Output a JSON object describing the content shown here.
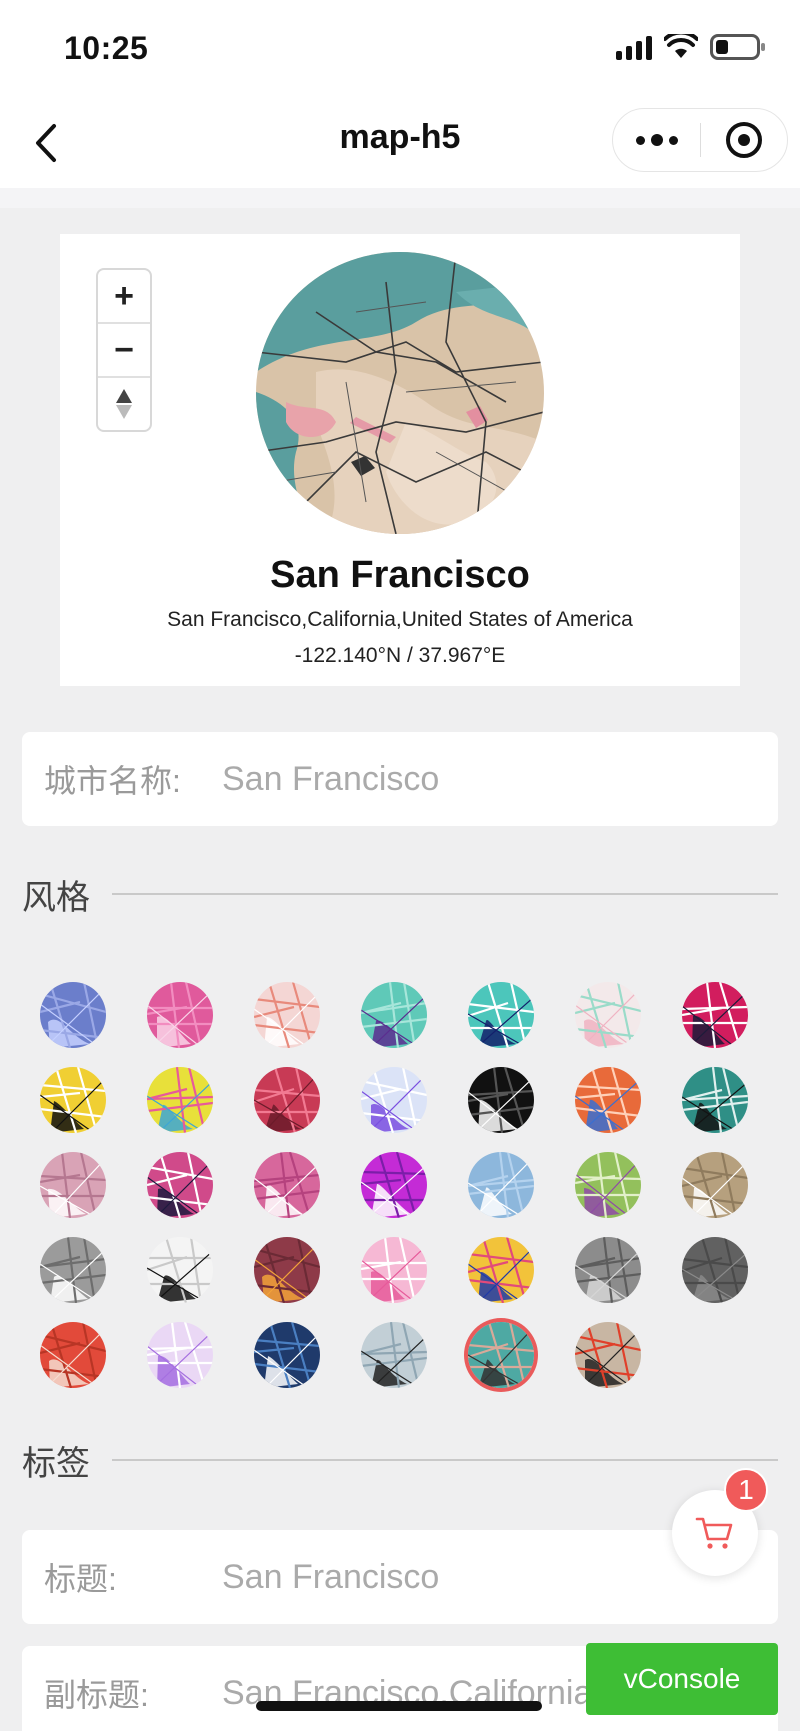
{
  "status_bar": {
    "time": "10:25"
  },
  "nav": {
    "title": "map-h5"
  },
  "preview": {
    "city": "San Francisco",
    "location": "San Francisco,California,United States of America",
    "coordinates": "-122.140°N / 37.967°E",
    "zoom_in": "+",
    "zoom_out": "−"
  },
  "city_field": {
    "label": "城市名称:",
    "value": "San Francisco"
  },
  "style_section": {
    "title": "风格"
  },
  "styles": [
    {
      "name": "style-1",
      "bg": "#6b7ecb",
      "fg": "#c5d0ff",
      "accent": "#9aa8e6"
    },
    {
      "name": "style-2",
      "bg": "#e05a9c",
      "fg": "#f9d4e8",
      "accent": "#f28dc0"
    },
    {
      "name": "style-3",
      "bg": "#f4d6d4",
      "fg": "#ffffff",
      "accent": "#e88a7c"
    },
    {
      "name": "style-4",
      "bg": "#5fc9b8",
      "fg": "#5b2d8f",
      "accent": "#a7e6da"
    },
    {
      "name": "style-5",
      "bg": "#4cc6bb",
      "fg": "#13206b",
      "accent": "#ffffff"
    },
    {
      "name": "style-6",
      "bg": "#f3e9ea",
      "fg": "#f0b3c2",
      "accent": "#9adbc9"
    },
    {
      "name": "style-7",
      "bg": "#d21d5e",
      "fg": "#1d1b3a",
      "accent": "#ffffff"
    },
    {
      "name": "style-8",
      "bg": "#f0cf33",
      "fg": "#111111",
      "accent": "#ffffff"
    },
    {
      "name": "style-9",
      "bg": "#e8e03a",
      "fg": "#3ca6d6",
      "accent": "#e75a9a"
    },
    {
      "name": "style-10",
      "bg": "#c83a55",
      "fg": "#6b1b2a",
      "accent": "#f27a92"
    },
    {
      "name": "style-11",
      "bg": "#dbe3f7",
      "fg": "#7a4fe0",
      "accent": "#ffffff"
    },
    {
      "name": "style-12",
      "bg": "#111111",
      "fg": "#ffffff",
      "accent": "#555555"
    },
    {
      "name": "style-13",
      "bg": "#e86a3a",
      "fg": "#3a6fd1",
      "accent": "#ffd0b8"
    },
    {
      "name": "style-14",
      "bg": "#2f8f86",
      "fg": "#131313",
      "accent": "#e0f0ee"
    },
    {
      "name": "style-15",
      "bg": "#d9a3b6",
      "fg": "#ffffff",
      "accent": "#b57790"
    },
    {
      "name": "style-16",
      "bg": "#d04a8a",
      "fg": "#1d1a3e",
      "accent": "#ffffff"
    },
    {
      "name": "style-17",
      "bg": "#d7679c",
      "fg": "#ffffff",
      "accent": "#b5427e"
    },
    {
      "name": "style-18",
      "bg": "#c42bd6",
      "fg": "#ffffff",
      "accent": "#7b1ea8"
    },
    {
      "name": "style-19",
      "bg": "#8db7dc",
      "fg": "#ffffff",
      "accent": "#b4d2ee"
    },
    {
      "name": "style-20",
      "bg": "#93c05c",
      "fg": "#8f4aa7",
      "accent": "#e2f0c9"
    },
    {
      "name": "style-21",
      "bg": "#b6a07e",
      "fg": "#ffffff",
      "accent": "#8f7b5d"
    },
    {
      "name": "style-22",
      "bg": "#9b9b9b",
      "fg": "#ffffff",
      "accent": "#6d6d6d"
    },
    {
      "name": "style-23",
      "bg": "#f4f4f4",
      "fg": "#111111",
      "accent": "#c9c9c9"
    },
    {
      "name": "style-24",
      "bg": "#8e3a48",
      "fg": "#f2a33a",
      "accent": "#6b2a35"
    },
    {
      "name": "style-25",
      "bg": "#f6b8d4",
      "fg": "#e65a9a",
      "accent": "#ffffff"
    },
    {
      "name": "style-26",
      "bg": "#f2c33a",
      "fg": "#1f3aa8",
      "accent": "#e24a7a"
    },
    {
      "name": "style-27",
      "bg": "#8c8c8c",
      "fg": "#d6d6d6",
      "accent": "#5d5d5d"
    },
    {
      "name": "style-28",
      "bg": "#616161",
      "fg": "#8a8a8a",
      "accent": "#4a4a4a"
    },
    {
      "name": "style-29",
      "bg": "#e24a3a",
      "fg": "#f4dcd0",
      "accent": "#b83525"
    },
    {
      "name": "style-30",
      "bg": "#ead8f5",
      "fg": "#a56fe0",
      "accent": "#ffffff"
    },
    {
      "name": "style-31",
      "bg": "#1f3a6b",
      "fg": "#ffffff",
      "accent": "#4a7fc2"
    },
    {
      "name": "style-32",
      "bg": "#c2cfd6",
      "fg": "#222222",
      "accent": "#8fa6b3"
    },
    {
      "name": "style-33",
      "bg": "#4ea9a3",
      "fg": "#333333",
      "accent": "#d8a999"
    },
    {
      "name": "style-34",
      "bg": "#c8b6a3",
      "fg": "#222222",
      "accent": "#e0402a"
    }
  ],
  "selected_style": "style-33",
  "label_section": {
    "title": "标签"
  },
  "title_field": {
    "label": "标题:",
    "value": "San Francisco"
  },
  "subtitle_field": {
    "label": "副标题:",
    "value": "San Francisco,California"
  },
  "cart": {
    "badge": "1"
  },
  "vconsole": {
    "label": "vConsole"
  }
}
